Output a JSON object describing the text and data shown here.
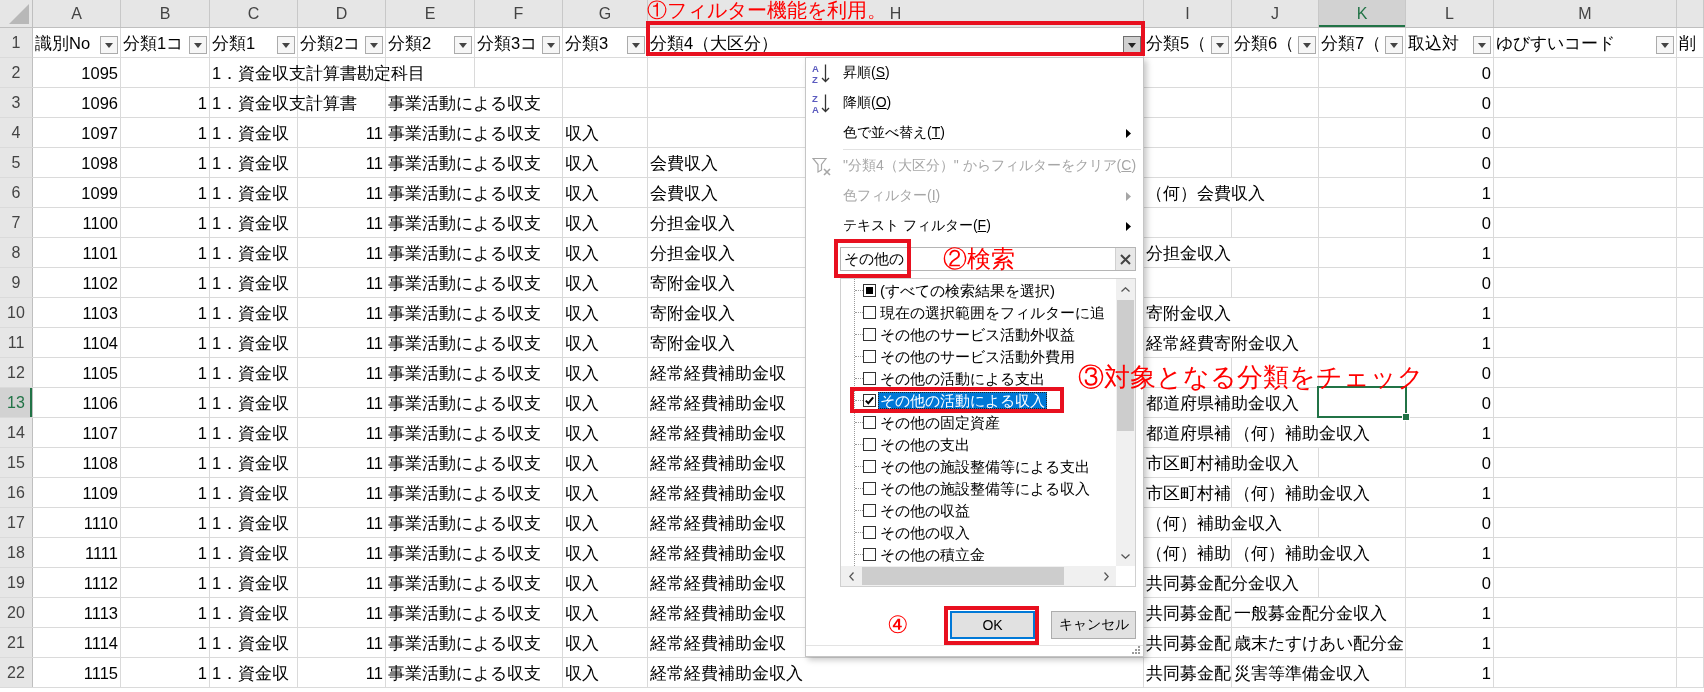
{
  "sheet": {
    "columns": [
      {
        "label": "A",
        "kind": "number",
        "selected": false
      },
      {
        "label": "B",
        "kind": "number",
        "selected": false
      },
      {
        "label": "C",
        "kind": "text",
        "selected": false
      },
      {
        "label": "D",
        "kind": "number",
        "selected": false
      },
      {
        "label": "E",
        "kind": "text",
        "selected": false
      },
      {
        "label": "F",
        "kind": "text",
        "selected": false
      },
      {
        "label": "G",
        "kind": "text",
        "selected": false
      },
      {
        "label": "H",
        "kind": "text",
        "selected": false
      },
      {
        "label": "I",
        "kind": "text",
        "selected": false
      },
      {
        "label": "J",
        "kind": "text",
        "selected": false
      },
      {
        "label": "K",
        "kind": "text",
        "selected": true
      },
      {
        "label": "L",
        "kind": "number",
        "selected": false
      },
      {
        "label": "M",
        "selected": false
      },
      {
        "selected": false
      }
    ],
    "header_row": {
      "number": "1",
      "selected": false,
      "cells": [
        {
          "text": "識別No",
          "filter": true,
          "open": false,
          "highlighted": false
        },
        {
          "text": "分類1コ",
          "filter": true,
          "open": false,
          "highlighted": false
        },
        {
          "text": "分類1",
          "filter": true,
          "open": false,
          "highlighted": false
        },
        {
          "text": "分類2コ",
          "filter": true,
          "open": false,
          "highlighted": false
        },
        {
          "text": "分類2",
          "filter": true,
          "open": false,
          "highlighted": false
        },
        {
          "text": "分類3コ",
          "filter": true,
          "open": false,
          "highlighted": false
        },
        {
          "text": "分類3",
          "filter": true,
          "open": false,
          "highlighted": false
        },
        {
          "text": "分類4（大区分）",
          "filter": true,
          "open": true,
          "highlighted": true,
          "note": "①フィルター機能を利用。"
        },
        {
          "text": "分類5（",
          "filter": true,
          "open": false,
          "highlighted": false
        },
        {
          "text": "分類6（",
          "filter": true,
          "open": false,
          "highlighted": false
        },
        {
          "text": "分類7（",
          "filter": true,
          "open": false,
          "highlighted": false
        },
        {
          "text": "取込対",
          "filter": true,
          "open": false,
          "highlighted": false
        },
        {
          "text": "ゆびすいコード",
          "filter": true,
          "open": false,
          "highlighted": false
        },
        {
          "text": "削",
          "filter": false,
          "highlighted": false
        }
      ]
    },
    "rows": [
      {
        "number": "2",
        "selected": false,
        "cells": [
          "1095",
          null,
          "1．資金収支計算書勘定科目",
          null,
          null,
          null,
          null,
          null,
          null,
          null,
          null,
          "0"
        ]
      },
      {
        "number": "3",
        "selected": false,
        "cells": [
          "1096",
          "1",
          "1．資金収支計算書",
          null,
          "事業活動による収支",
          null,
          null,
          null,
          null,
          null,
          null,
          "0"
        ]
      },
      {
        "number": "4",
        "selected": false,
        "cells": [
          "1097",
          "1",
          "1．資金収",
          "11",
          "事業活動による収支",
          null,
          "収入",
          null,
          null,
          null,
          null,
          "0"
        ]
      },
      {
        "number": "5",
        "selected": false,
        "cells": [
          "1098",
          "1",
          "1．資金収",
          "11",
          "事業活動による収支",
          null,
          "収入",
          "会費収入",
          null,
          null,
          null,
          "0"
        ]
      },
      {
        "number": "6",
        "selected": false,
        "cells": [
          "1099",
          "1",
          "1．資金収",
          "11",
          "事業活動による収支",
          null,
          "収入",
          "会費収入",
          "（何）会費収入",
          null,
          null,
          "1"
        ]
      },
      {
        "number": "7",
        "selected": false,
        "cells": [
          "1100",
          "1",
          "1．資金収",
          "11",
          "事業活動による収支",
          null,
          "収入",
          "分担金収入",
          null,
          null,
          null,
          "0"
        ]
      },
      {
        "number": "8",
        "selected": false,
        "cells": [
          "1101",
          "1",
          "1．資金収",
          "11",
          "事業活動による収支",
          null,
          "収入",
          "分担金収入",
          "分担金収入",
          null,
          null,
          "1"
        ]
      },
      {
        "number": "9",
        "selected": false,
        "cells": [
          "1102",
          "1",
          "1．資金収",
          "11",
          "事業活動による収支",
          null,
          "収入",
          "寄附金収入",
          null,
          null,
          null,
          "0"
        ]
      },
      {
        "number": "10",
        "selected": false,
        "cells": [
          "1103",
          "1",
          "1．資金収",
          "11",
          "事業活動による収支",
          null,
          "収入",
          "寄附金収入",
          "寄附金収入",
          null,
          null,
          "1"
        ]
      },
      {
        "number": "11",
        "selected": false,
        "cells": [
          "1104",
          "1",
          "1．資金収",
          "11",
          "事業活動による収支",
          null,
          "収入",
          "寄附金収入",
          "経常経費寄附金収入",
          null,
          null,
          "1"
        ]
      },
      {
        "number": "12",
        "selected": false,
        "cells": [
          "1105",
          "1",
          "1．資金収",
          "11",
          "事業活動による収支",
          null,
          "収入",
          "経常経費補助金収",
          null,
          null,
          null,
          "0"
        ]
      },
      {
        "number": "13",
        "selected": true,
        "cells": [
          "1106",
          "1",
          "1．資金収",
          "11",
          "事業活動による収支",
          null,
          "収入",
          "経常経費補助金収",
          "都道府県補助金収入",
          null,
          null,
          "0"
        ]
      },
      {
        "number": "14",
        "selected": false,
        "cells": [
          "1107",
          "1",
          "1．資金収",
          "11",
          "事業活動による収支",
          null,
          "収入",
          "経常経費補助金収",
          "都道府県補",
          "（何）補助金収入",
          null,
          "1"
        ]
      },
      {
        "number": "15",
        "selected": false,
        "cells": [
          "1108",
          "1",
          "1．資金収",
          "11",
          "事業活動による収支",
          null,
          "収入",
          "経常経費補助金収",
          "市区町村補助金収入",
          null,
          null,
          "0"
        ]
      },
      {
        "number": "16",
        "selected": false,
        "cells": [
          "1109",
          "1",
          "1．資金収",
          "11",
          "事業活動による収支",
          null,
          "収入",
          "経常経費補助金収",
          "市区町村補",
          "（何）補助金収入",
          null,
          "1"
        ]
      },
      {
        "number": "17",
        "selected": false,
        "cells": [
          "1110",
          "1",
          "1．資金収",
          "11",
          "事業活動による収支",
          null,
          "収入",
          "経常経費補助金収",
          "（何）補助金収入",
          null,
          null,
          "0"
        ]
      },
      {
        "number": "18",
        "selected": false,
        "cells": [
          "1111",
          "1",
          "1．資金収",
          "11",
          "事業活動による収支",
          null,
          "収入",
          "経常経費補助金収",
          "（何）補助",
          "（何）補助金収入",
          null,
          "1"
        ]
      },
      {
        "number": "19",
        "selected": false,
        "cells": [
          "1112",
          "1",
          "1．資金収",
          "11",
          "事業活動による収支",
          null,
          "収入",
          "経常経費補助金収",
          "共同募金配分金収入",
          null,
          null,
          "0"
        ]
      },
      {
        "number": "20",
        "selected": false,
        "cells": [
          "1113",
          "1",
          "1．資金収",
          "11",
          "事業活動による収支",
          null,
          "収入",
          "経常経費補助金収",
          "共同募金配",
          "一般募金配分金収入",
          null,
          "1"
        ]
      },
      {
        "number": "21",
        "selected": false,
        "cells": [
          "1114",
          "1",
          "1．資金収",
          "11",
          "事業活動による収支",
          null,
          "収入",
          "経常経費補助金収",
          "共同募金配",
          "歳末たすけあい配分金",
          null,
          "1"
        ]
      },
      {
        "number": "22",
        "selected": false,
        "cells": [
          "1115",
          "1",
          "1．資金収",
          "11",
          "事業活動による収支",
          null,
          "収入",
          "経常経費補助金収入",
          "共同募金配",
          "災害等準備金収入",
          null,
          "1"
        ]
      }
    ]
  },
  "filter_menu": {
    "items": [
      {
        "kind": "sort",
        "icon_top": "A",
        "icon_bottom": "Z",
        "label": "昇順(",
        "key": "S",
        "end": ")",
        "disabled": false
      },
      {
        "kind": "sort",
        "icon_top": "Z",
        "icon_bottom": "A",
        "label": "降順(",
        "key": "O",
        "end": ")",
        "disabled": false
      },
      {
        "kind": "submenu",
        "label": "色で並べ替え(",
        "key": "T",
        "end": ")",
        "disabled": false
      },
      {
        "kind": "separator"
      },
      {
        "kind": "clear_filter",
        "label": "\"分類4（大区分）\" からフィルターをクリア(",
        "key": "C",
        "end": ")",
        "disabled": true
      },
      {
        "kind": "submenu",
        "label": "色フィルター(",
        "key": "I",
        "end": ")",
        "disabled": true
      },
      {
        "kind": "submenu",
        "label": "テキスト フィルター(",
        "key": "F",
        "end": ")",
        "disabled": false
      }
    ],
    "search": {
      "value": "その他の",
      "highlighted": true,
      "note": "②検索"
    },
    "list": [
      {
        "label": "(すべての検索結果を選択)",
        "checked": false,
        "mixed": true,
        "selected": false,
        "highlighted": false
      },
      {
        "label": "現在の選択範囲をフィルターに追",
        "checked": false,
        "mixed": false,
        "selected": false,
        "highlighted": false
      },
      {
        "label": "その他のサービス活動外収益",
        "checked": false,
        "mixed": false,
        "selected": false,
        "highlighted": false
      },
      {
        "label": "その他のサービス活動外費用",
        "checked": false,
        "mixed": false,
        "selected": false,
        "highlighted": false
      },
      {
        "label": "その他の活動による支出",
        "checked": false,
        "mixed": false,
        "selected": false,
        "highlighted": false
      },
      {
        "label": "その他の活動による収入",
        "checked": true,
        "mixed": false,
        "selected": true,
        "highlighted": true,
        "note": "③対象となる分類をチェック"
      },
      {
        "label": "その他の固定資産",
        "checked": false,
        "mixed": false,
        "selected": false,
        "highlighted": false
      },
      {
        "label": "その他の支出",
        "checked": false,
        "mixed": false,
        "selected": false,
        "highlighted": false
      },
      {
        "label": "その他の施設整備等による支出",
        "checked": false,
        "mixed": false,
        "selected": false,
        "highlighted": false
      },
      {
        "label": "その他の施設整備等による収入",
        "checked": false,
        "mixed": false,
        "selected": false,
        "highlighted": false
      },
      {
        "label": "その他の収益",
        "checked": false,
        "mixed": false,
        "selected": false,
        "highlighted": false
      },
      {
        "label": "その他の収入",
        "checked": false,
        "mixed": false,
        "selected": false,
        "highlighted": false
      },
      {
        "label": "その他の積立金",
        "checked": false,
        "mixed": false,
        "selected": false,
        "highlighted": false
      }
    ],
    "buttons": [
      {
        "label": "OK",
        "default": true,
        "highlighted": true,
        "note": "④"
      },
      {
        "label": "キャンセル",
        "default": false,
        "highlighted": false
      }
    ]
  }
}
